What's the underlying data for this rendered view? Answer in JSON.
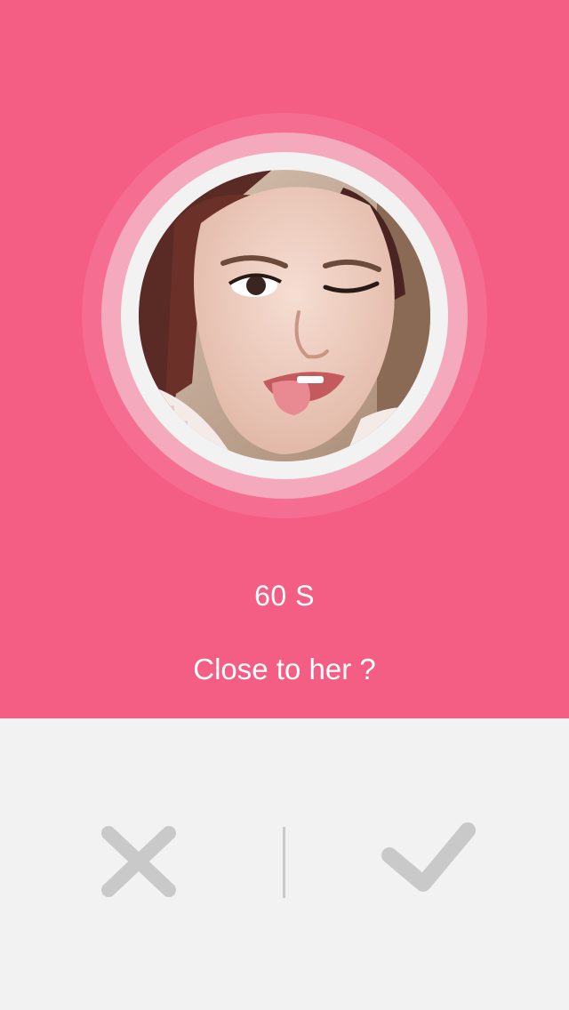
{
  "profile": {
    "timer_text": "60 S",
    "question_text": "Close to her ?"
  },
  "actions": {
    "reject_icon": "close-icon",
    "accept_icon": "check-icon"
  },
  "colors": {
    "accent": "#f45d84",
    "ring_light": "#f4a9bc",
    "background": "#f2f2f2",
    "icon_gray": "#c9c9c9",
    "text": "#ffffff"
  }
}
